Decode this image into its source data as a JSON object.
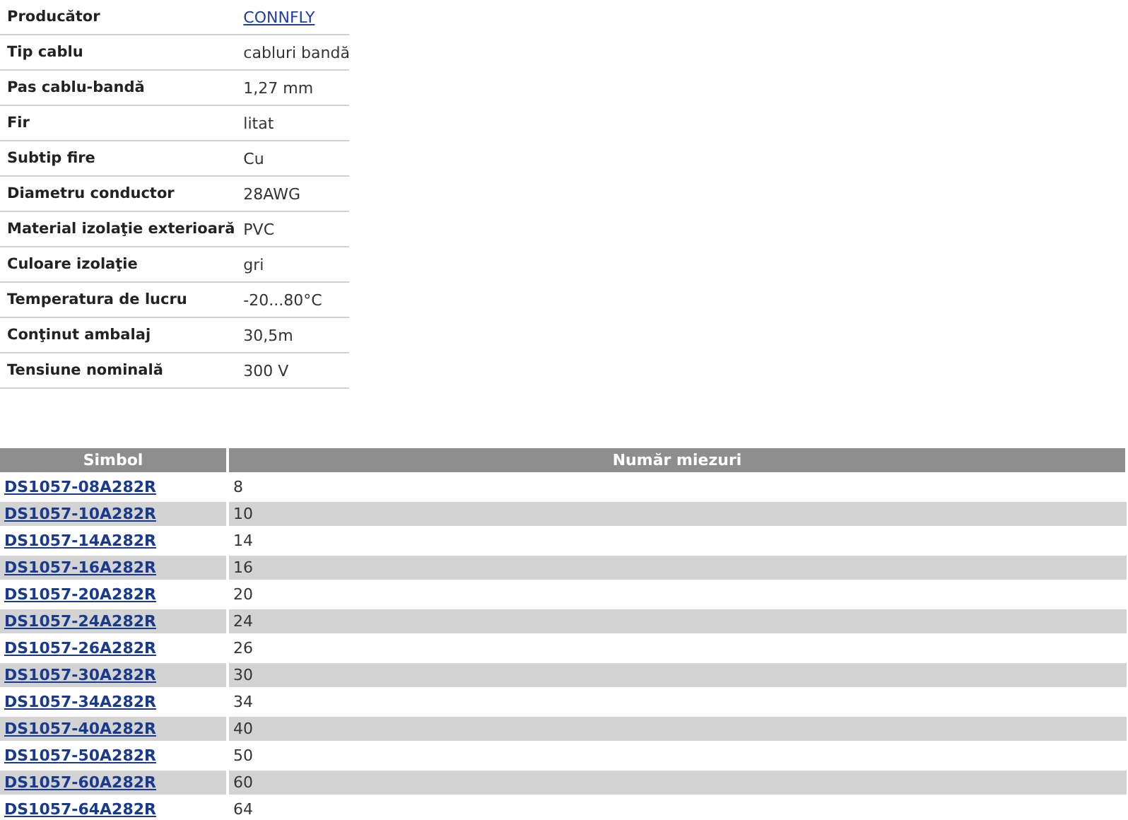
{
  "specs": [
    {
      "label": "Producător",
      "value": "CONNFLY",
      "link": true
    },
    {
      "label": "Tip cablu",
      "value": "cabluri bandă",
      "link": false
    },
    {
      "label": "Pas cablu-bandă",
      "value": "1,27 mm",
      "link": false
    },
    {
      "label": "Fir",
      "value": "litat",
      "link": false
    },
    {
      "label": "Subtip fire",
      "value": "Cu",
      "link": false
    },
    {
      "label": "Diametru conductor",
      "value": "28AWG",
      "link": false
    },
    {
      "label": "Material izolaţie exterioară",
      "value": "PVC",
      "link": false
    },
    {
      "label": "Culoare izolaţie",
      "value": "gri",
      "link": false
    },
    {
      "label": "Temperatura de lucru",
      "value": "-20...80°C",
      "link": false
    },
    {
      "label": "Conţinut ambalaj",
      "value": "30,5m",
      "link": false
    },
    {
      "label": "Tensiune nominală",
      "value": "300 V",
      "link": false
    }
  ],
  "variants": {
    "columns": [
      "Simbol",
      "Număr miezuri"
    ],
    "rows": [
      [
        "DS1057-08A282R",
        "8"
      ],
      [
        "DS1057-10A282R",
        "10"
      ],
      [
        "DS1057-14A282R",
        "14"
      ],
      [
        "DS1057-16A282R",
        "16"
      ],
      [
        "DS1057-20A282R",
        "20"
      ],
      [
        "DS1057-24A282R",
        "24"
      ],
      [
        "DS1057-26A282R",
        "26"
      ],
      [
        "DS1057-30A282R",
        "30"
      ],
      [
        "DS1057-34A282R",
        "34"
      ],
      [
        "DS1057-40A282R",
        "40"
      ],
      [
        "DS1057-50A282R",
        "50"
      ],
      [
        "DS1057-60A282R",
        "60"
      ],
      [
        "DS1057-64A282R",
        "64"
      ]
    ]
  }
}
